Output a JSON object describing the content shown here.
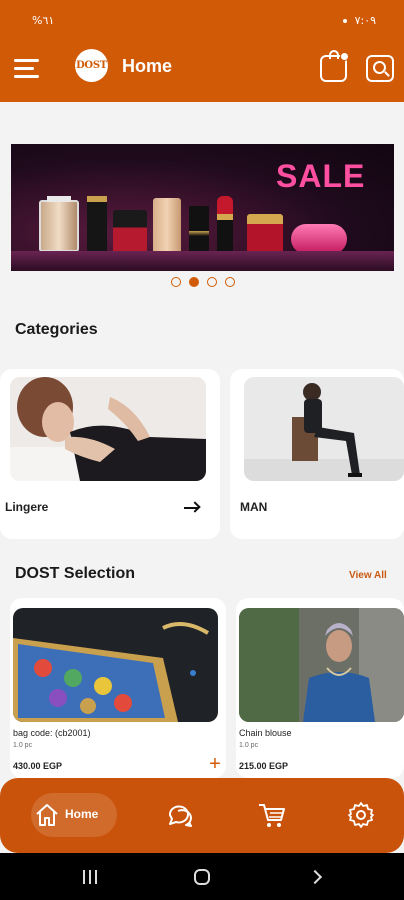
{
  "status_bar": {
    "left": "%٦١",
    "right": "٧:٠٩"
  },
  "app_bar": {
    "logo_text": "DOST",
    "title": "Home"
  },
  "banner": {
    "sale_text": "SALE",
    "slide_count": 4,
    "active_slide": 2
  },
  "categories": {
    "title": "Categories",
    "items": [
      {
        "label": "Lingere",
        "image": "woman-lingerie-photo"
      },
      {
        "label": "MAN",
        "image": "man-seated-suit-photo"
      }
    ]
  },
  "selection": {
    "title": "DOST Selection",
    "view_all": "View All",
    "products": [
      {
        "name": "bag code: (cb2001)",
        "qty": "1.0 pc",
        "price": "430.00 EGP",
        "image": "gucci-bag-photo"
      },
      {
        "name": "Chain blouse",
        "qty": "1.0 pc",
        "price": "215.00 EGP",
        "image": "woman-blue-blouse-photo"
      }
    ]
  },
  "bottom_nav": {
    "home_label": "Home",
    "items": [
      "home-icon",
      "chat-icon",
      "cart-icon",
      "gear-icon"
    ]
  },
  "colors": {
    "primary": "#d15a06",
    "nav": "#c9530a",
    "background": "#f3f3f3"
  }
}
